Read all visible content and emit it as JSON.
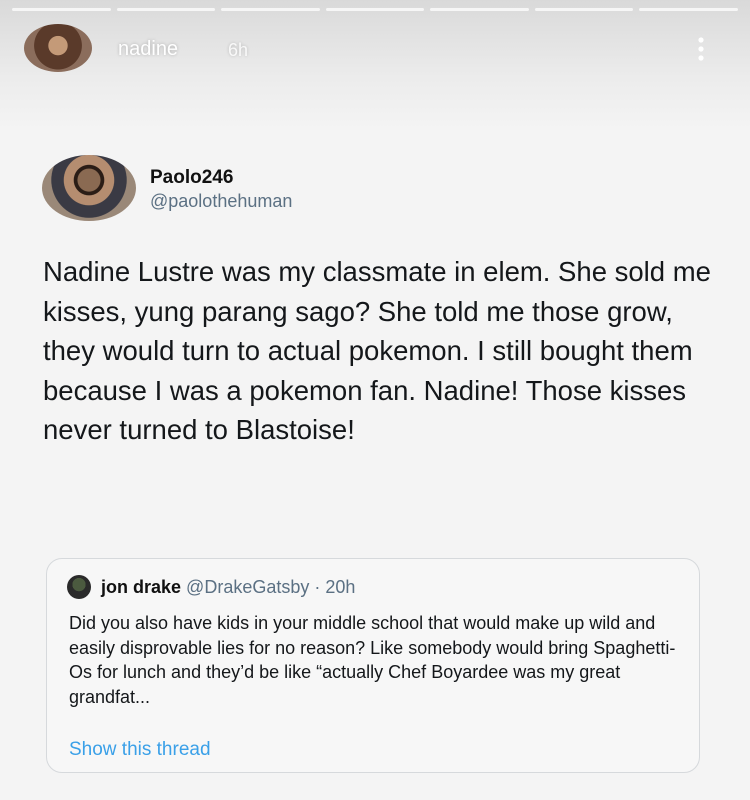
{
  "story": {
    "username": "nadine",
    "time": "6h",
    "progress_segments": 7
  },
  "tweet": {
    "author": {
      "name": "Paolo246",
      "handle": "@paolothehuman"
    },
    "text": "Nadine Lustre was my classmate in elem. She sold me kisses, yung parang sago? She told me those grow, they would turn to actual pokemon. I still bought them because I was a pokemon fan. Nadine! Those kisses never turned to Blastoise!"
  },
  "quote": {
    "name": "jon drake",
    "meta": "@DrakeGatsby · 20h",
    "text": "Did you also have kids in your middle school that would make up wild and easily disprovable lies for no reason? Like somebody would bring Spaghetti-Os for lunch and they’d be like “actually Chef Boyardee was my great grandfat...",
    "show_thread_label": "Show this thread"
  },
  "icons": {
    "menu": "more-vertical-icon"
  },
  "colors": {
    "link": "#3aa0e8",
    "handle": "#5b7083"
  }
}
